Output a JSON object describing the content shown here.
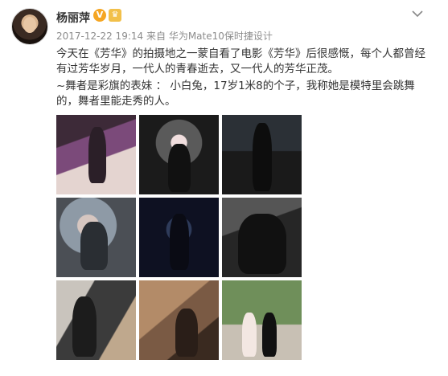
{
  "post": {
    "author_name": "杨丽萍",
    "badge_verified": "V",
    "timestamp": "2017-12-22 19:14",
    "source_prefix": "来自",
    "source_device": "华为Mate10保时捷设计",
    "text_line1": "今天在《芳华》的拍摄地之一蒙自看了电影《芳华》后很感慨，每个人都曾经有过芳华岁月，一代人的青春逝去，又一代人的芳华正茂。",
    "text_line2": "~舞者是彩旗的表妹 ： 小白兔，17岁1米8的个子，我称她是模特里会跳舞的，舞者里能走秀的人。"
  },
  "images": [
    {
      "icon": "photo-icon"
    },
    {
      "icon": "photo-icon"
    },
    {
      "icon": "photo-icon"
    },
    {
      "icon": "photo-icon"
    },
    {
      "icon": "photo-icon"
    },
    {
      "icon": "photo-icon"
    },
    {
      "icon": "photo-icon"
    },
    {
      "icon": "photo-icon"
    },
    {
      "icon": "photo-icon"
    }
  ],
  "colors": {
    "text": "#333333",
    "meta": "#8c8c8c",
    "badge": "#f5a623",
    "background": "#ffffff"
  }
}
